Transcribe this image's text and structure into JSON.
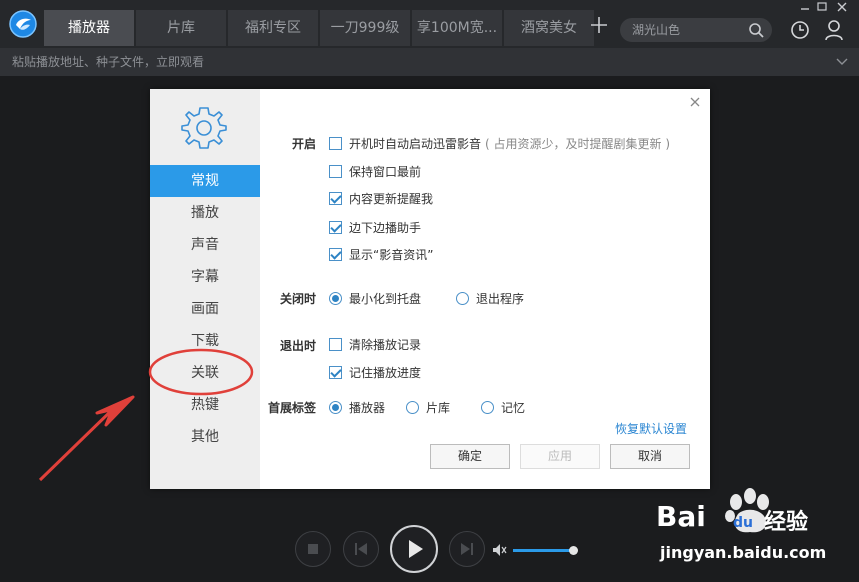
{
  "topbar": {
    "tabs": [
      {
        "label": "播放器",
        "active": true
      },
      {
        "label": "片库",
        "active": false
      },
      {
        "label": "福利专区",
        "active": false
      },
      {
        "label": "一刀999级",
        "active": false
      },
      {
        "label": "享100M宽...",
        "active": false
      },
      {
        "label": "酒窝美女",
        "active": false
      }
    ],
    "search_placeholder": "湖光山色"
  },
  "urlbar": {
    "placeholder": "粘贴播放地址、种子文件，立即观看"
  },
  "dialog": {
    "sidebar": [
      {
        "label": "常规",
        "active": true
      },
      {
        "label": "播放",
        "active": false
      },
      {
        "label": "声音",
        "active": false
      },
      {
        "label": "字幕",
        "active": false
      },
      {
        "label": "画面",
        "active": false
      },
      {
        "label": "下载",
        "active": false
      },
      {
        "label": "关联",
        "active": false
      },
      {
        "label": "热键",
        "active": false
      },
      {
        "label": "其他",
        "active": false
      }
    ],
    "startup": {
      "label": "开启",
      "options": [
        {
          "label": "开机时自动启动迅雷影音",
          "hint": "( 占用资源少，及时提醒剧集更新 )",
          "checked": false
        },
        {
          "label": "保持窗口最前",
          "checked": false
        },
        {
          "label": "内容更新提醒我",
          "checked": true
        },
        {
          "label": "边下边播助手",
          "checked": true
        },
        {
          "label": "显示“影音资讯”",
          "checked": true
        }
      ]
    },
    "on_close": {
      "label": "关闭时",
      "options": [
        {
          "label": "最小化到托盘",
          "selected": true
        },
        {
          "label": "退出程序",
          "selected": false
        }
      ]
    },
    "on_exit": {
      "label": "退出时",
      "options": [
        {
          "label": "清除播放记录",
          "checked": false
        },
        {
          "label": "记住播放进度",
          "checked": true
        }
      ]
    },
    "first_tab": {
      "label": "首展标签",
      "options": [
        {
          "label": "播放器",
          "selected": true
        },
        {
          "label": "片库",
          "selected": false
        },
        {
          "label": "记忆",
          "selected": false
        }
      ]
    },
    "restore_label": "恢复默认设置",
    "buttons": {
      "ok": "确定",
      "apply": "应用",
      "cancel": "取消"
    }
  },
  "player": {
    "volume_level": 0.92
  },
  "watermark": {
    "brand_a": "Bai",
    "brand_b": "du",
    "brand_c": "经验",
    "url": "jingyan.baidu.com"
  },
  "colors": {
    "accent": "#2b9ae8",
    "annotation": "#e0403a"
  }
}
